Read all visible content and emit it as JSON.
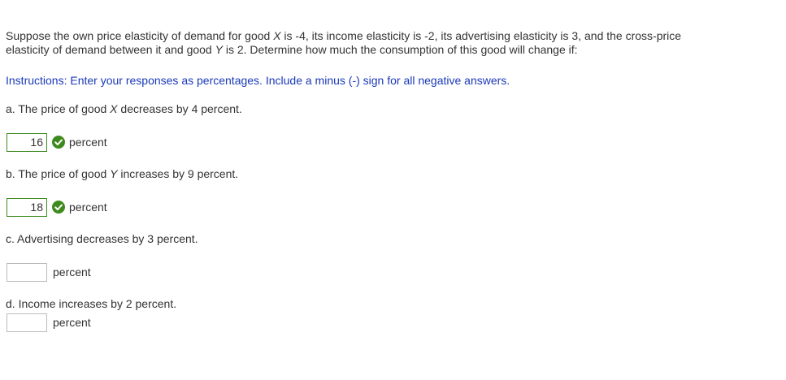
{
  "problem": {
    "line1_part1": "Suppose the own price elasticity of demand for good ",
    "var_x": "X",
    "line1_part2": " is -4, its income elasticity is -2, its advertising elasticity is 3, and the cross-price",
    "line2_part1": "elasticity of demand between it and good ",
    "var_y": "Y",
    "line2_part2": " is 2. Determine how much the consumption of this good will change if:"
  },
  "instructions": "Instructions: Enter your responses as percentages. Include a minus (-) sign for all negative answers.",
  "questions": [
    {
      "prefix": "a. The price of good ",
      "var": "X",
      "suffix": " decreases by 4 percent.",
      "answer_value": "16",
      "status": "correct",
      "unit": "percent"
    },
    {
      "prefix": "b. The price of good ",
      "var": "Y",
      "suffix": " increases by 9 percent.",
      "answer_value": "18",
      "status": "correct",
      "unit": "percent"
    },
    {
      "text": "c. Advertising decreases by 3 percent.",
      "answer_value": "",
      "status": "unanswered",
      "unit": "percent"
    },
    {
      "text": "d. Income increases by 2 percent.",
      "answer_value": "",
      "status": "unanswered",
      "unit": "percent"
    }
  ],
  "colors": {
    "instructions": "#1a39b8",
    "correct_check": "#3f8a1f",
    "text": "#333333"
  },
  "icons": {
    "correct": "check-circle-icon"
  }
}
